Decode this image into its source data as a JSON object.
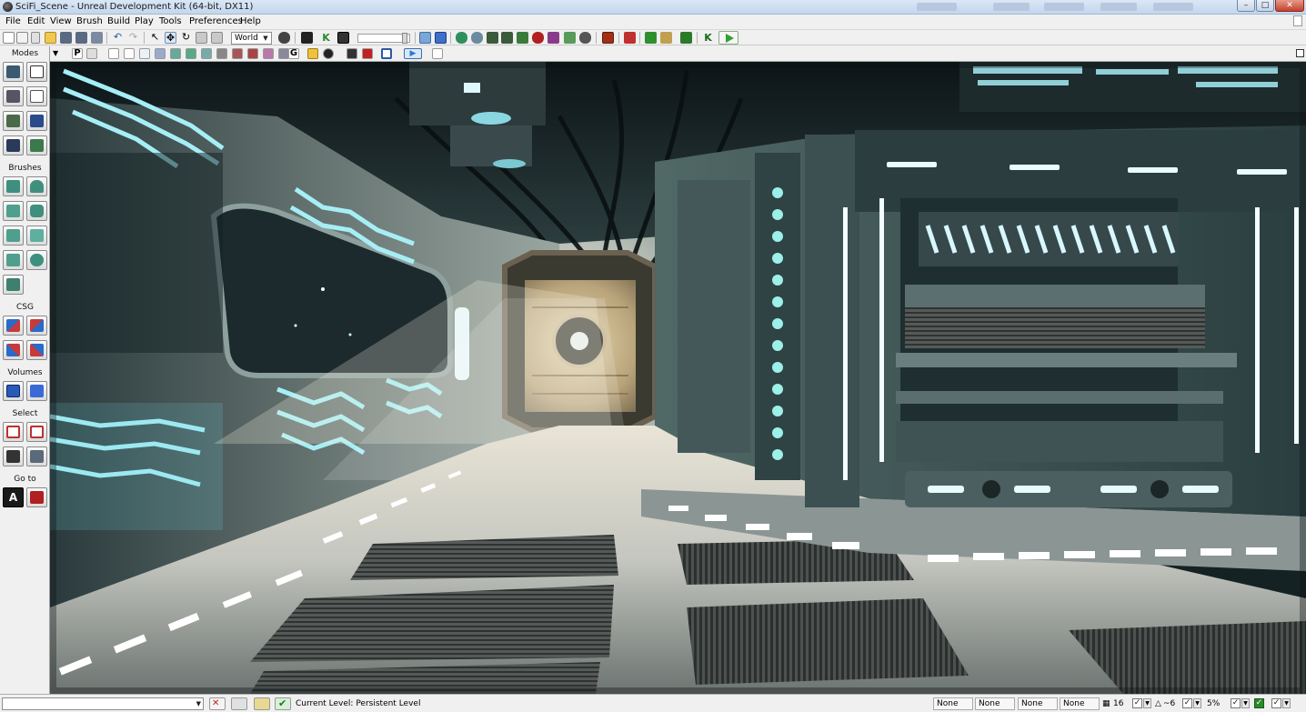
{
  "window": {
    "title": "SciFi_Scene - Unreal Development Kit (64-bit, DX11)",
    "buttons": {
      "minimize": "–",
      "maximize": "□",
      "close": "✕"
    }
  },
  "menu": [
    "File",
    "Edit",
    "View",
    "Brush",
    "Build",
    "Play",
    "Tools",
    "Preferences",
    "Help"
  ],
  "toolbar": {
    "coordinate_system": "World",
    "icons": [
      "new-icon",
      "open-icon",
      "save-icon",
      "save-all-icon",
      "undo-icon",
      "redo-icon",
      "select-icon",
      "translate-icon",
      "rotate-icon",
      "scale-icon",
      "binoculars-icon",
      "kismet-icon",
      "build-geometry-icon",
      "build-lighting-icon",
      "build-paths-icon",
      "build-all-icon",
      "play-in-editor-icon"
    ],
    "colors": {
      "play": "#2ea12e"
    }
  },
  "modes_panel": {
    "title": "Modes",
    "sections": {
      "brushes": "Brushes",
      "csg": "CSG",
      "volumes": "Volumes",
      "select": "Select",
      "goto": "Go to"
    },
    "goto_button_letter": "A"
  },
  "viewport_toolbar": {
    "perspective_letter": "P",
    "game_letter": "G"
  },
  "status_bar": {
    "current_level": "Current Level:  Persistent Level",
    "snap_fields": [
      "None",
      "None",
      "None",
      "None"
    ],
    "grid_size": "16",
    "rotation_snap": "~6",
    "scale_snap": "5%"
  }
}
